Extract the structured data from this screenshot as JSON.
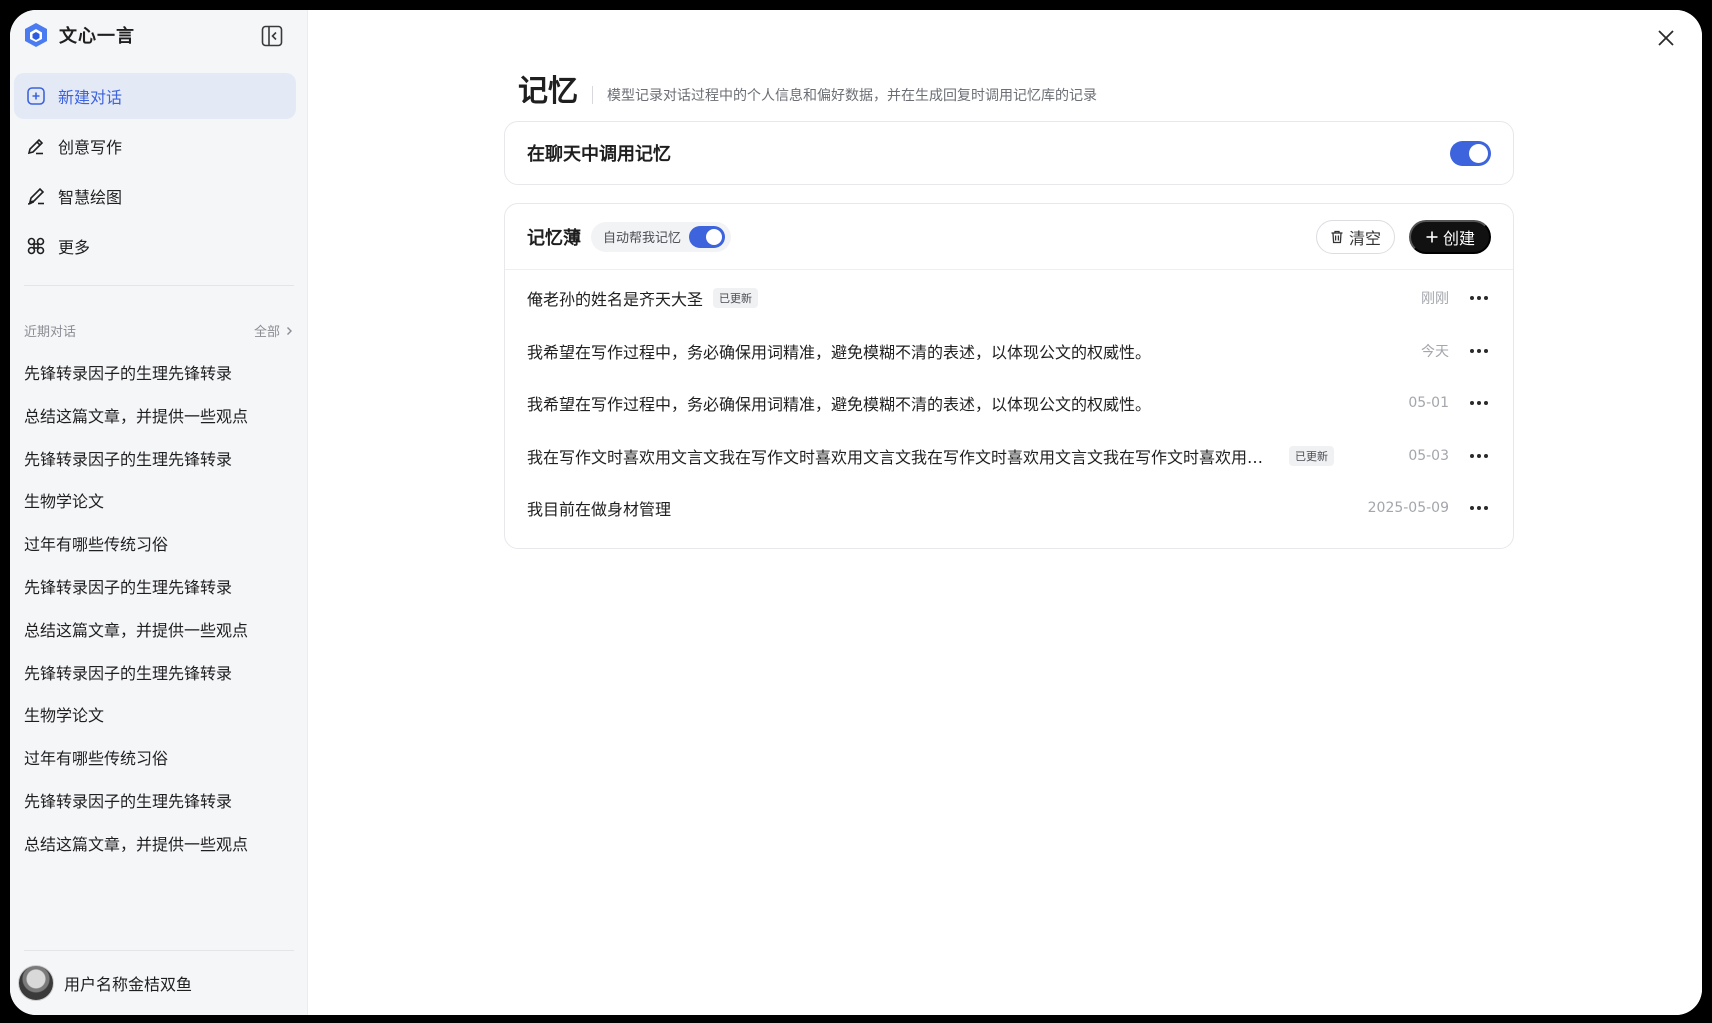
{
  "app": {
    "name": "文心一言",
    "brand_color": "#3d63dd"
  },
  "sidebar": {
    "nav": [
      {
        "label": "新建对话",
        "icon": "new-chat-icon",
        "active": true
      },
      {
        "label": "创意写作",
        "icon": "pen-icon",
        "active": false
      },
      {
        "label": "智慧绘图",
        "icon": "brush-icon",
        "active": false
      },
      {
        "label": "更多",
        "icon": "command-icon",
        "active": false
      }
    ],
    "recent_title": "近期对话",
    "recent_all": "全部",
    "recent": [
      "先锋转录因子的生理先锋转录",
      "总结这篇文章，并提供一些观点",
      "先锋转录因子的生理先锋转录",
      "生物学论文",
      "过年有哪些传统习俗",
      "先锋转录因子的生理先锋转录",
      "总结这篇文章，并提供一些观点",
      "先锋转录因子的生理先锋转录",
      "生物学论文",
      "过年有哪些传统习俗",
      "先锋转录因子的生理先锋转录",
      "总结这篇文章，并提供一些观点"
    ],
    "user_name": "用户名称金桔双鱼"
  },
  "main": {
    "title": "记忆",
    "description": "模型记录对话过程中的个人信息和偏好数据，并在生成回复时调用记忆库的记录",
    "use_memory_label": "在聊天中调用记忆",
    "use_memory_on": true,
    "notebook": {
      "title": "记忆薄",
      "auto_label": "自动帮我记忆",
      "auto_on": true,
      "clear_label": "清空",
      "create_label": "创建",
      "updated_tag": "已更新",
      "items": [
        {
          "text": "俺老孙的姓名是齐天大圣",
          "updated": true,
          "time": "刚刚"
        },
        {
          "text": "我希望在写作过程中，务必确保用词精准，避免模糊不清的表述，以体现公文的权威性。",
          "updated": false,
          "time": "今天"
        },
        {
          "text": "我希望在写作过程中，务必确保用词精准，避免模糊不清的表述，以体现公文的权威性。",
          "updated": false,
          "time": "05-01"
        },
        {
          "text": "我在写作文时喜欢用文言文我在写作文时喜欢用文言文我在写作文时喜欢用文言文我在写作文时喜欢用文言文我在写作文时喜欢用文言文",
          "updated": true,
          "time": "05-03"
        },
        {
          "text": "我目前在做身材管理",
          "updated": false,
          "time": "2025-05-09"
        }
      ]
    }
  }
}
